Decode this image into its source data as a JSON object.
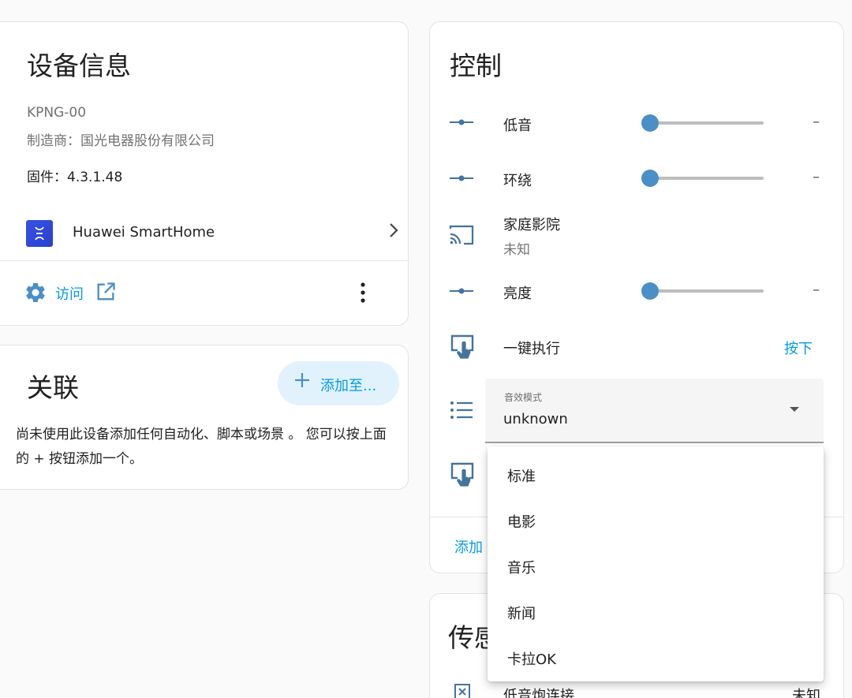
{
  "device_info": {
    "title": "设备信息",
    "model": "KPNG-00",
    "manufacturer": "制造商：国光电器股份有限公司",
    "firmware": "固件：4.3.1.48",
    "integration_name": "Huawei SmartHome",
    "visit_label": "访问"
  },
  "related": {
    "title": "关联",
    "add_button_label": "添加至...",
    "description": "尚未使用此设备添加任何自动化、脚本或场景 。 您可以按上面的 + 按钮添加一个。"
  },
  "control": {
    "title": "控制",
    "bass": {
      "label": "低音",
      "value_text": "–"
    },
    "surround": {
      "label": "环绕",
      "value_text": "–"
    },
    "home_theater": {
      "label": "家庭影院",
      "status": "未知"
    },
    "brightness": {
      "label": "亮度",
      "value_text": "–"
    },
    "one_click": {
      "label": "一键执行",
      "action_label": "按下"
    },
    "sound_mode": {
      "label": "音效模式",
      "value": "unknown"
    },
    "add_label": "添加"
  },
  "sound_mode_options": [
    "标准",
    "电影",
    "音乐",
    "新闻",
    "卡拉OK"
  ],
  "sensors": {
    "title": "传感",
    "row_label": "低音炮连接",
    "row_value": "未知"
  },
  "colors": {
    "accent": "#039be5",
    "slider_thumb": "#4a8fc7",
    "icon": "#44739e"
  }
}
